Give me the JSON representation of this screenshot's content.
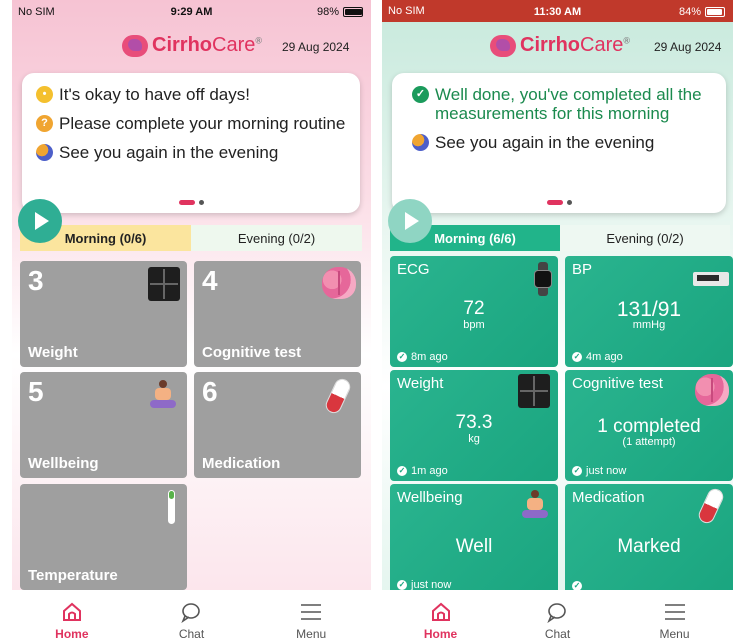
{
  "left": {
    "status": {
      "carrier": "No SIM",
      "time": "9:29 AM",
      "battery": "98%",
      "battery_level": 0.98
    },
    "brand": {
      "name_bold": "Cirrho",
      "name_light": "Care",
      "mark": "®"
    },
    "date": "29 Aug 2024",
    "messages": [
      {
        "icon": "worried-face-icon",
        "text": "It's okay to have off days!"
      },
      {
        "icon": "warning-icon",
        "text": "Please complete your morning routine"
      },
      {
        "icon": "moon-icon",
        "text": "See you again in the evening"
      }
    ],
    "tabs": {
      "morning": "Morning (0/6)",
      "evening": "Evening (0/2)"
    },
    "tiles": [
      {
        "num": "3",
        "label": "Weight",
        "icon": "scale-icon"
      },
      {
        "num": "4",
        "label": "Cognitive test",
        "icon": "brain-icon"
      },
      {
        "num": "5",
        "label": "Wellbeing",
        "icon": "yoga-icon"
      },
      {
        "num": "6",
        "label": "Medication",
        "icon": "pill-icon"
      },
      {
        "num": "",
        "label": "Temperature",
        "icon": "thermometer-icon"
      }
    ],
    "nav": {
      "home": "Home",
      "chat": "Chat",
      "menu": "Menu"
    }
  },
  "right": {
    "status": {
      "carrier": "No SIM",
      "time": "11:30 AM",
      "battery": "84%",
      "battery_level": 0.84
    },
    "brand": {
      "name_bold": "Cirrho",
      "name_light": "Care",
      "mark": "®"
    },
    "date": "29 Aug 2024",
    "messages": [
      {
        "icon": "check-icon",
        "text": "Well done, you've completed all the measurements for this morning"
      },
      {
        "icon": "moon-icon",
        "text": "See you again in the evening"
      }
    ],
    "tabs": {
      "morning": "Morning (6/6)",
      "evening": "Evening (0/2)"
    },
    "tiles": [
      {
        "title": "ECG",
        "value": "72",
        "unit": "bpm",
        "ago": "8m ago",
        "icon": "smartwatch-icon"
      },
      {
        "title": "BP",
        "value": "131/91",
        "unit": "mmHg",
        "ago": "4m ago",
        "icon": "bp-monitor-icon"
      },
      {
        "title": "Weight",
        "value": "73.3",
        "unit": "kg",
        "ago": "1m ago",
        "icon": "scale-icon"
      },
      {
        "title": "Cognitive test",
        "value": "1 completed",
        "sub": "(1 attempt)",
        "ago": "just now",
        "icon": "brain-icon"
      },
      {
        "title": "Wellbeing",
        "value": "Well",
        "ago": "just now",
        "icon": "yoga-icon"
      },
      {
        "title": "Medication",
        "value": "Marked",
        "ago": "",
        "icon": "pill-icon"
      }
    ],
    "nav": {
      "home": "Home",
      "chat": "Chat",
      "menu": "Menu"
    }
  },
  "colors": {
    "brand": "#e0335f",
    "teal": "#1aa57f",
    "status_red": "#c0392b"
  }
}
